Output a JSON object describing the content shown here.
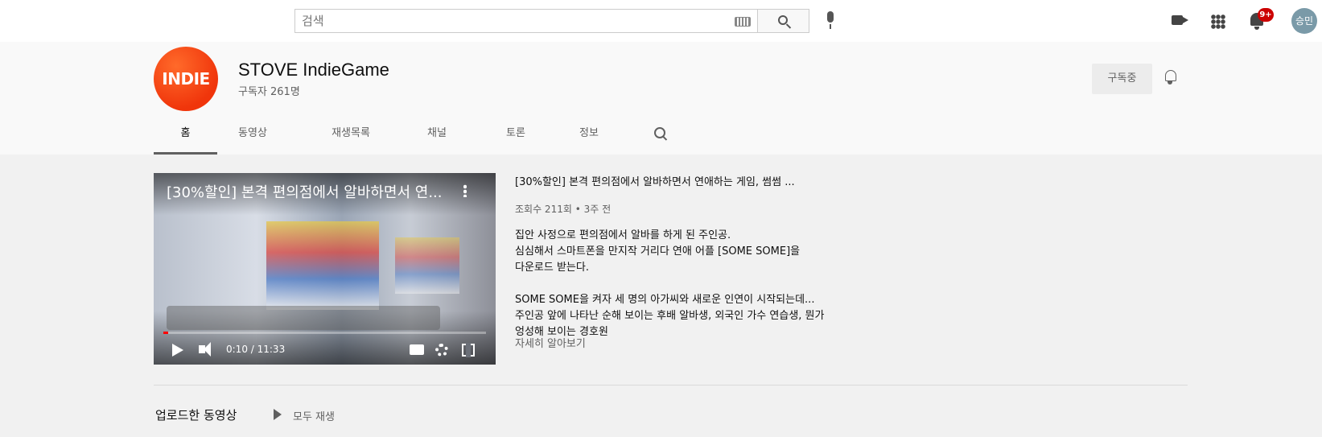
{
  "masthead": {
    "search_placeholder": "검색",
    "notification_badge": "9+",
    "avatar_text": "승민",
    "icons": [
      "keyboard-icon",
      "search-icon",
      "mic-icon",
      "create-video-icon",
      "apps-icon",
      "notifications-icon"
    ]
  },
  "channel": {
    "logo_text": "INDIE",
    "name": "STOVE IndieGame",
    "subscriber_count": "구독자 261명",
    "subscribed_label": "구독중",
    "tabs": [
      "홈",
      "동영상",
      "재생목록",
      "채널",
      "토론",
      "정보"
    ],
    "active_tab": "홈"
  },
  "featured_video": {
    "player_title": "[30%할인] 본격 편의점에서 알바하면서 연...",
    "time": "0:10 / 11:33",
    "progress_fraction": 0.0145,
    "title": "[30%할인] 본격 편의점에서 알바하면서 연애하는 게임, 썸썸 ...",
    "meta": "조회수 211회 • 3주 전",
    "description": "집안 사정으로 편의점에서 알바를 하게 된 주인공.\n심심해서 스마트폰을 만지작 거리다 연애 어플 [SOME SOME]을\n다운로드 받는다.\n\nSOME SOME을 켜자 세 명의 아가씨와 새로운 인연이 시작되는데...\n주인공 앞에 나타난 순해 보이는 후배 알바생, 외국인 가수 연습생, 뭔가 엉성해 보이는 경호원",
    "read_more": "자세히 알아보기"
  },
  "uploads": {
    "section_title": "업로드한 동영상",
    "play_all": "모두 재생"
  },
  "colors": {
    "accent_red": "#cc0000",
    "logo_orange": "#f0350b",
    "progress_red": "#ff0000"
  }
}
